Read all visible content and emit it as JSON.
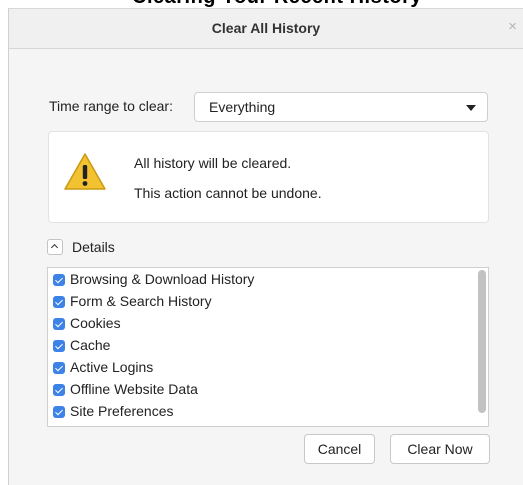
{
  "top_partial_text": "Clearing Your Recent History",
  "dialog": {
    "title": "Clear All History",
    "close_glyph": "×"
  },
  "time_range": {
    "label": "Time range to clear:",
    "selected": "Everything"
  },
  "warning": {
    "icon": "warning-triangle-icon",
    "line1": "All history will be cleared.",
    "line2": "This action cannot be undone."
  },
  "details": {
    "label": "Details",
    "items": [
      {
        "label": "Browsing & Download History",
        "checked": true
      },
      {
        "label": "Form & Search History",
        "checked": true
      },
      {
        "label": "Cookies",
        "checked": true
      },
      {
        "label": "Cache",
        "checked": true
      },
      {
        "label": "Active Logins",
        "checked": true
      },
      {
        "label": "Offline Website Data",
        "checked": true
      },
      {
        "label": "Site Preferences",
        "checked": true
      }
    ]
  },
  "buttons": {
    "cancel": "Cancel",
    "clear_now": "Clear Now"
  },
  "colors": {
    "checkbox": "#3d82e6",
    "warning_fill": "#f2c230",
    "dialog_bg": "#f5f5f5"
  }
}
